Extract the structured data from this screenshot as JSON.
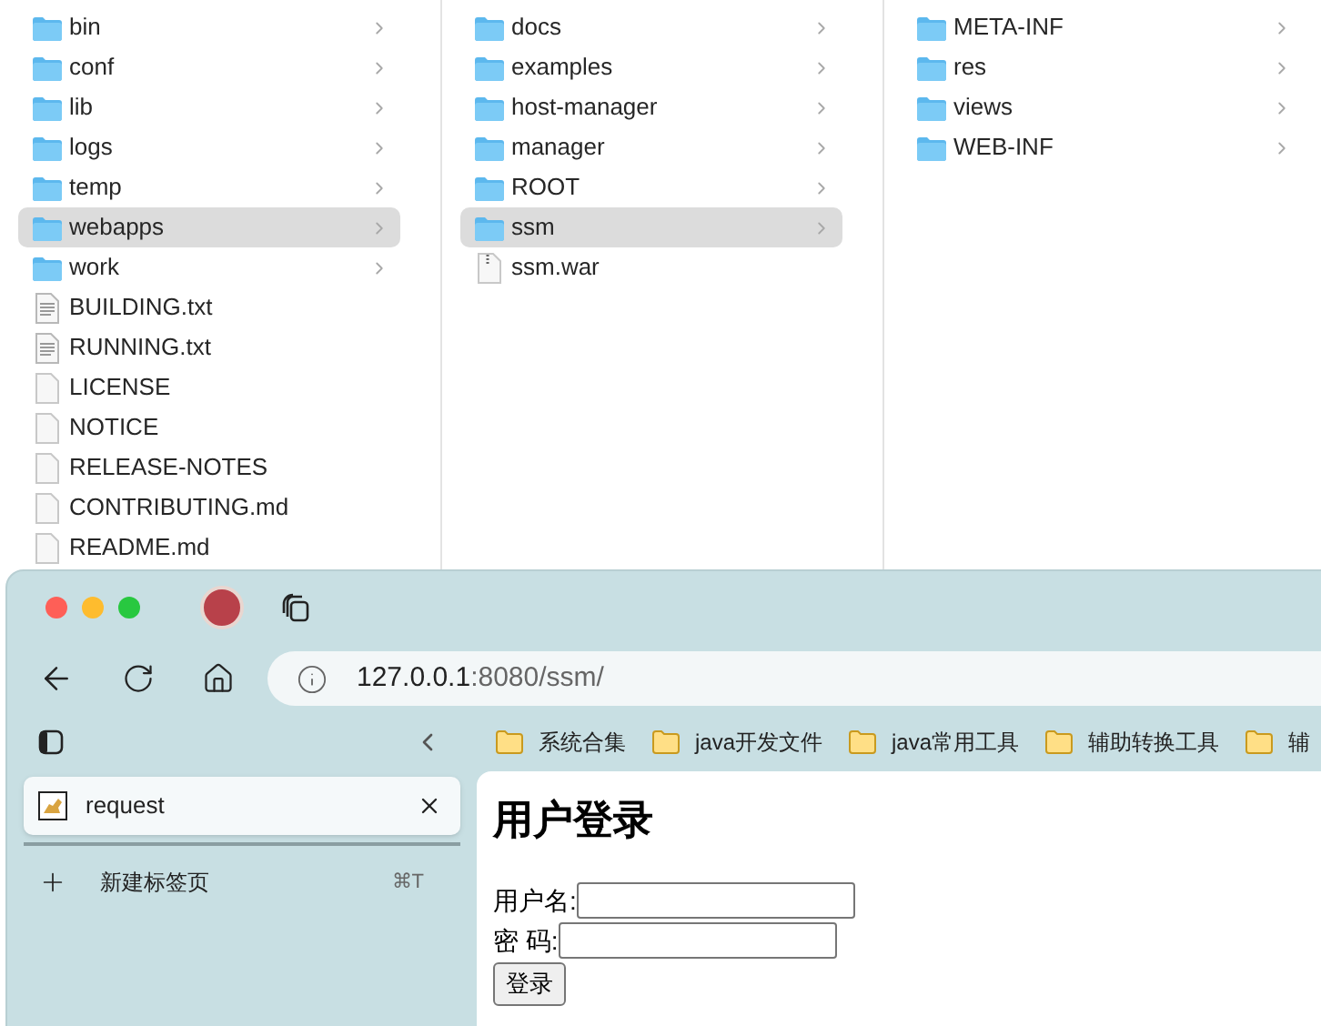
{
  "finder": {
    "columns": [
      {
        "items": [
          {
            "name": "bin",
            "kind": "folder",
            "selected": false
          },
          {
            "name": "conf",
            "kind": "folder",
            "selected": false
          },
          {
            "name": "lib",
            "kind": "folder",
            "selected": false
          },
          {
            "name": "logs",
            "kind": "folder",
            "selected": false
          },
          {
            "name": "temp",
            "kind": "folder",
            "selected": false
          },
          {
            "name": "webapps",
            "kind": "folder",
            "selected": true
          },
          {
            "name": "work",
            "kind": "folder",
            "selected": false
          },
          {
            "name": "BUILDING.txt",
            "kind": "text",
            "selected": false
          },
          {
            "name": "RUNNING.txt",
            "kind": "text",
            "selected": false
          },
          {
            "name": "LICENSE",
            "kind": "file",
            "selected": false
          },
          {
            "name": "NOTICE",
            "kind": "file",
            "selected": false
          },
          {
            "name": "RELEASE-NOTES",
            "kind": "file",
            "selected": false
          },
          {
            "name": "CONTRIBUTING.md",
            "kind": "file",
            "selected": false
          },
          {
            "name": "README.md",
            "kind": "file",
            "selected": false
          }
        ]
      },
      {
        "items": [
          {
            "name": "docs",
            "kind": "folder",
            "selected": false
          },
          {
            "name": "examples",
            "kind": "folder",
            "selected": false
          },
          {
            "name": "host-manager",
            "kind": "folder",
            "selected": false
          },
          {
            "name": "manager",
            "kind": "folder",
            "selected": false
          },
          {
            "name": "ROOT",
            "kind": "folder",
            "selected": false
          },
          {
            "name": "ssm",
            "kind": "folder",
            "selected": true
          },
          {
            "name": "ssm.war",
            "kind": "archive",
            "selected": false
          }
        ]
      },
      {
        "items": [
          {
            "name": "META-INF",
            "kind": "folder",
            "selected": false
          },
          {
            "name": "res",
            "kind": "folder",
            "selected": false
          },
          {
            "name": "views",
            "kind": "folder",
            "selected": false
          },
          {
            "name": "WEB-INF",
            "kind": "folder",
            "selected": false
          }
        ]
      }
    ]
  },
  "browser": {
    "address": {
      "host": "127.0.0.1",
      "rest": ":8080/ssm/"
    },
    "bookmarks": [
      "系统合集",
      "java开发文件",
      "java常用工具",
      "辅助转换工具",
      "辅"
    ],
    "sidebar": {
      "tabs": [
        {
          "title": "request",
          "selected": true
        }
      ],
      "new_tab": {
        "label": "新建标签页",
        "shortcut": "⌘T"
      }
    },
    "page": {
      "heading": "用户登录",
      "fields": [
        {
          "label": "用户名:"
        },
        {
          "label": "密 码:"
        }
      ],
      "submit": "登录"
    }
  }
}
